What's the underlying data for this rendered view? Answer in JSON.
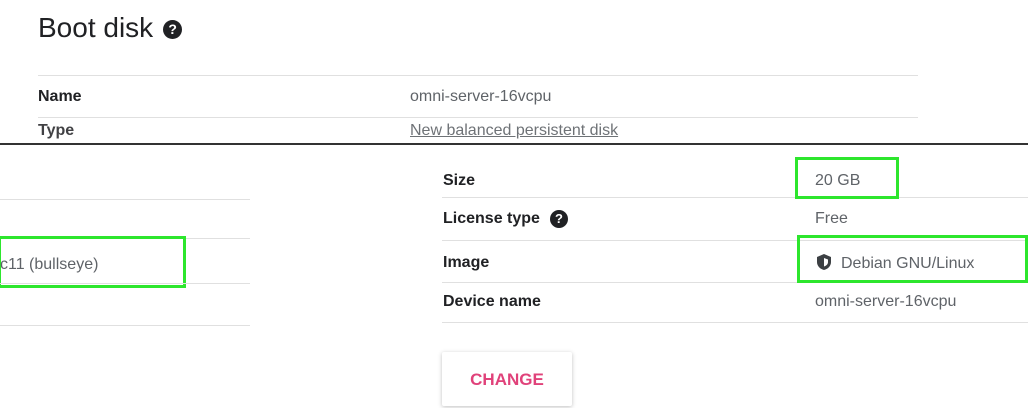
{
  "section": {
    "title": "Boot disk"
  },
  "top_table": {
    "name_label": "Name",
    "name_value": "omni-server-16vcpu",
    "type_label": "Type",
    "type_value": "New balanced persistent disk"
  },
  "left_fragment": {
    "image_value_partial": "c11 (bullseye)"
  },
  "details": {
    "size_label": "Size",
    "size_value": "20 GB",
    "license_label": "License type",
    "license_value": "Free",
    "image_label": "Image",
    "image_value": "Debian GNU/Linux",
    "device_label": "Device name",
    "device_value": "omni-server-16vcpu"
  },
  "actions": {
    "change_label": "CHANGE"
  },
  "colors": {
    "accent": "#e0427a",
    "highlight": "#2de62d",
    "text": "#202124",
    "muted": "#5f6368"
  },
  "icons": [
    "help-icon",
    "shield-icon"
  ]
}
